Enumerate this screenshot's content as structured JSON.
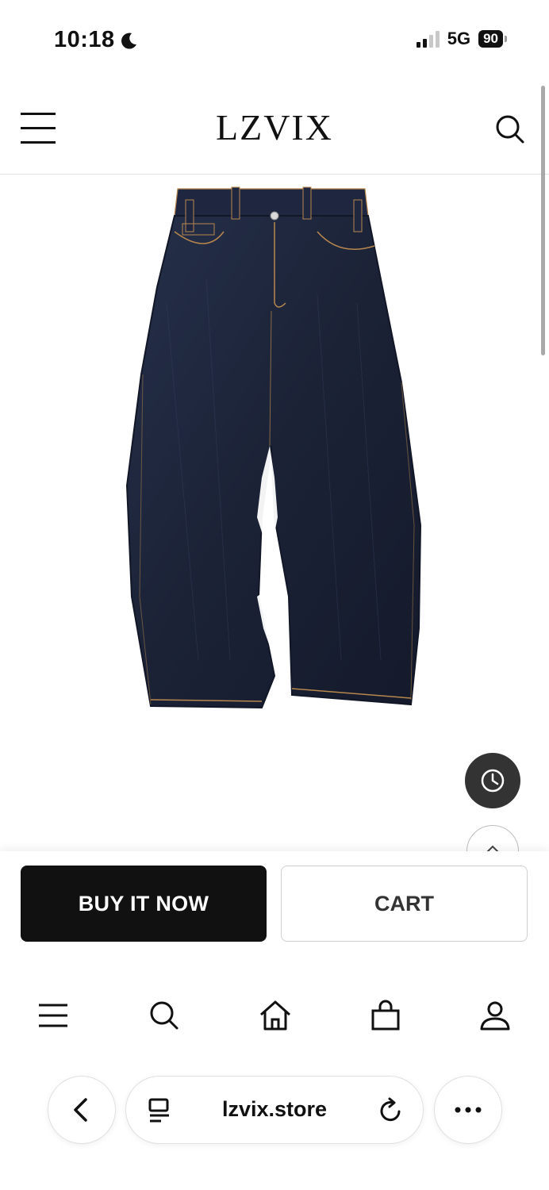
{
  "status_bar": {
    "time": "10:18",
    "network": "5G",
    "battery": "90",
    "icons": [
      "moon-icon",
      "signal-icon",
      "battery-icon"
    ]
  },
  "header": {
    "logo": "LZVIX",
    "icons": [
      "menu-icon",
      "search-icon"
    ]
  },
  "product": {
    "image": "dark-indigo-wide-leg-jeans"
  },
  "floating": {
    "icons": [
      "recent-view-icon",
      "scroll-top-icon"
    ]
  },
  "actions": {
    "buy_label": "BUY IT NOW",
    "cart_label": "CART"
  },
  "bottom_nav": {
    "icons": [
      "menu-icon",
      "search-icon",
      "home-icon",
      "bag-icon",
      "user-icon"
    ]
  },
  "browser": {
    "url": "lzvix.store",
    "icons": [
      "back-icon",
      "reader-icon",
      "reload-icon",
      "more-icon"
    ]
  },
  "colors": {
    "accent": "#111111",
    "denim": "#1c2236",
    "stitch": "#b8874e"
  }
}
